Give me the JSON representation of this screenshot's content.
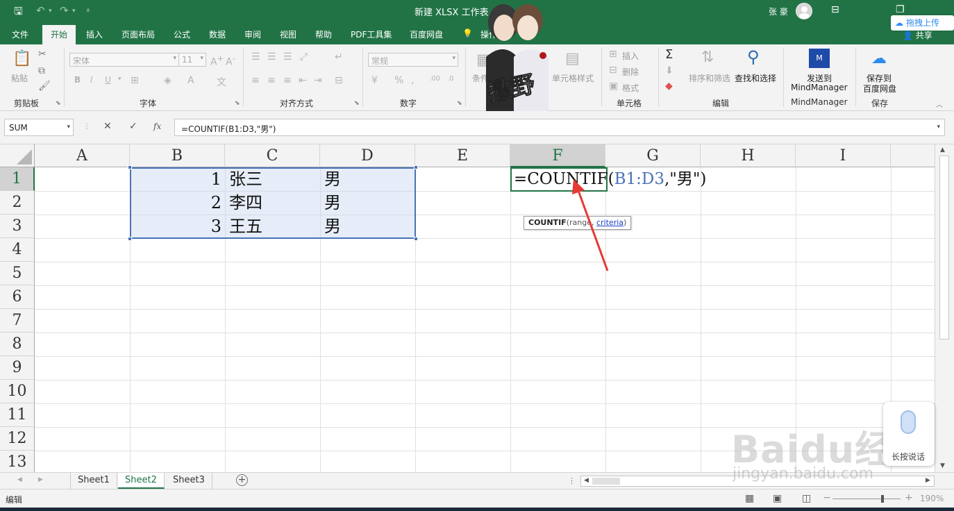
{
  "window": {
    "title": "新建 XLSX 工作表.x",
    "user": "张 豪",
    "upload_badge": "拖拽上传"
  },
  "menu": {
    "tabs": [
      "文件",
      "开始",
      "插入",
      "页面布局",
      "公式",
      "数据",
      "审阅",
      "视图",
      "帮助",
      "PDF工具集",
      "百度网盘"
    ],
    "tell_me": "操作",
    "share": "共享"
  },
  "ribbon": {
    "clipboard": {
      "paste": "粘贴",
      "label": "剪贴板"
    },
    "font": {
      "name": "宋体",
      "size": "11",
      "label": "字体",
      "bold": "B",
      "italic": "I",
      "underline": "U"
    },
    "alignment": {
      "label": "对齐方式"
    },
    "number": {
      "format": "常规",
      "label": "数字"
    },
    "styles": {
      "conditional": "条件",
      "cell_styles": "单元格样式",
      "label": "样"
    },
    "cells": {
      "insert": "插入",
      "delete": "删除",
      "format": "格式",
      "label": "单元格"
    },
    "editing": {
      "sort_filter": "排序和筛选",
      "find_select": "查找和选择",
      "label": "编辑"
    },
    "mindmanager": {
      "send_line1": "发送到",
      "send_line2": "MindManager",
      "label": "MindManager"
    },
    "save": {
      "line1": "保存到",
      "line2": "百度网盘",
      "label": "保存"
    }
  },
  "formula_bar": {
    "name_box": "SUM",
    "formula": "=COUNTIF(B1:D3,\"男\")",
    "fx": "fx"
  },
  "grid": {
    "columns": [
      "A",
      "B",
      "C",
      "D",
      "E",
      "F",
      "G",
      "H",
      "I"
    ],
    "rows": [
      "1",
      "2",
      "3",
      "4",
      "5",
      "6",
      "7",
      "8",
      "9",
      "10",
      "11",
      "12",
      "13"
    ],
    "cells": {
      "B1": "1",
      "C1": "张三",
      "D1": "男",
      "B2": "2",
      "C2": "李四",
      "D2": "男",
      "B3": "3",
      "C3": "王五",
      "D3": "男"
    },
    "edit_formula": {
      "prefix": "=COUNTIF(",
      "ref": "B1:D3",
      "suffix": ",\"男\")"
    },
    "tooltip": {
      "func": "COUNTIF",
      "open": "(",
      "arg1": "range",
      "sep": ", ",
      "arg2": "criteria",
      "close": ")"
    }
  },
  "sheets": [
    "Sheet1",
    "Sheet2",
    "Sheet3"
  ],
  "status": {
    "mode": "编辑",
    "zoom": "190%"
  },
  "overlays": {
    "voice_label": "长按说话",
    "watermark": "Baidu经验",
    "watermark_url": "jingyan.baidu.com",
    "decor_text": "撒野"
  },
  "colors": {
    "excel_green": "#217346",
    "selection_blue": "#4a72b8",
    "annotation_red": "#e53935"
  }
}
